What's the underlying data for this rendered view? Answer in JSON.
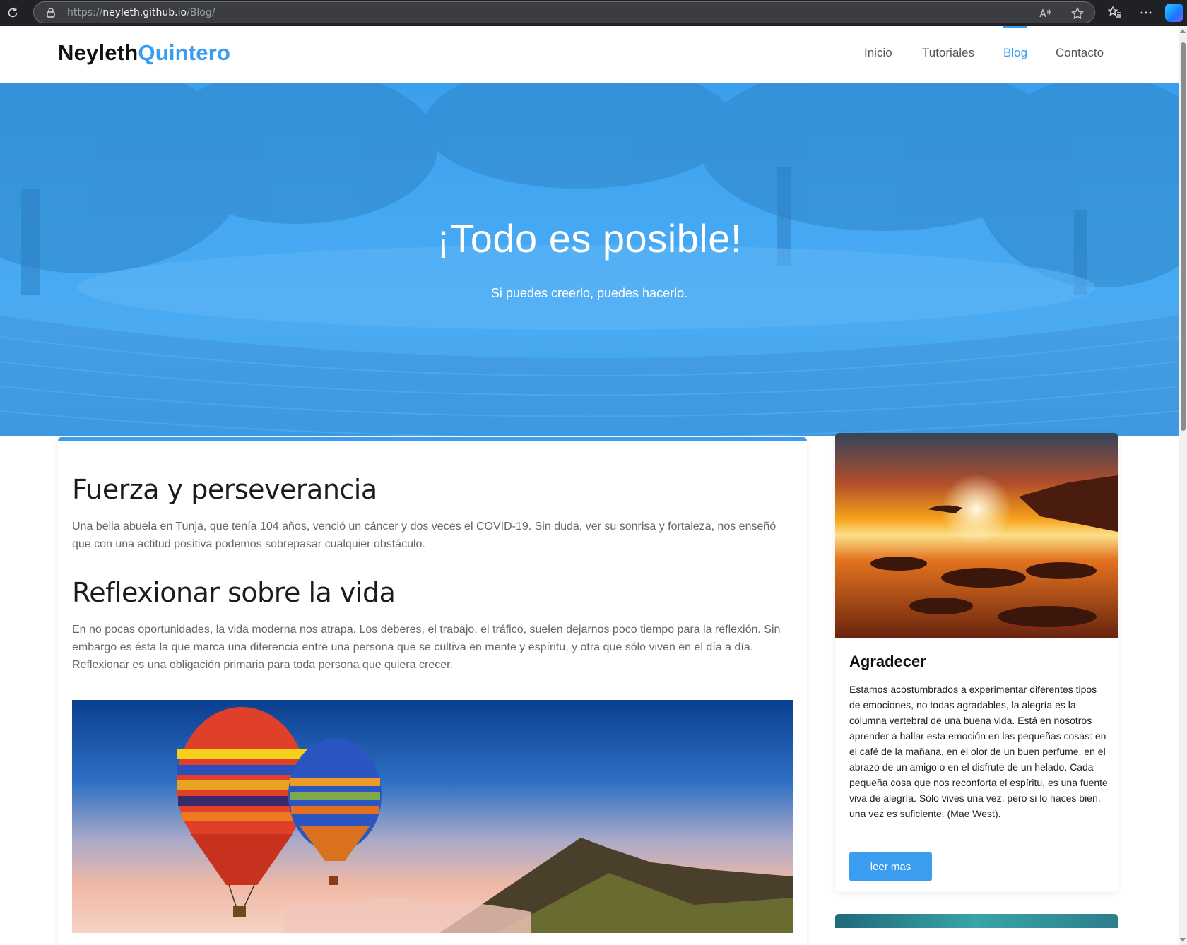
{
  "browser": {
    "url_scheme": "https://",
    "url_host": "neyleth.github.io",
    "url_path": "/Blog/"
  },
  "brand": {
    "first": "Neyleth",
    "second": "Quintero",
    "accent_color": "#3b9df0"
  },
  "nav": {
    "items": [
      {
        "label": "Inicio",
        "active": false
      },
      {
        "label": "Tutoriales",
        "active": false
      },
      {
        "label": "Blog",
        "active": true
      },
      {
        "label": "Contacto",
        "active": false
      }
    ]
  },
  "hero": {
    "title": "¡Todo es posible!",
    "subtitle": "Si puedes creerlo, puedes hacerlo."
  },
  "article": {
    "sections": [
      {
        "heading": "Fuerza y perseverancia",
        "text": "Una bella abuela en Tunja, que tenía 104 años, venció un cáncer y dos veces el COVID-19. Sin duda, ver su sonrisa y fortaleza, nos enseñó que con una actitud positiva podemos sobrepasar cualquier obstáculo."
      },
      {
        "heading": "Reflexionar sobre la vida",
        "text": "En no pocas oportunidades, la vida moderna nos atrapa. Los deberes, el trabajo, el tráfico, suelen dejarnos poco tiempo para la reflexión. Sin embargo es ésta la que marca una diferencia entre una persona que se cultiva en mente y espíritu, y otra que sólo viven en el día a día. Reflexionar es una obligación primaria para toda persona que quiera crecer."
      }
    ]
  },
  "sidebar": {
    "card": {
      "title": "Agradecer",
      "body": "Estamos acostumbrados a experimentar diferentes tipos de emociones, no todas agradables, la alegría es la columna vertebral de una buena vida. Está en nosotros aprender a hallar esta emoción en las pequeñas cosas: en el café de la mañana, en el olor de un buen perfume, en el abrazo de un amigo o en el disfrute de un helado. Cada pequeña cosa que nos reconforta el espíritu, es una fuente viva de alegría. Sólo vives una vez, pero si lo haces bien, una vez es suficiente. (Mae West).",
      "button": "leer mas"
    }
  }
}
